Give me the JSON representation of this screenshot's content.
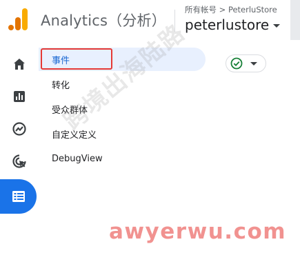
{
  "header": {
    "app_title": "Analytics（分析）",
    "account_path": "所有帐号 > PeterluStore",
    "property_name": "peterlustore"
  },
  "rail": {
    "items": [
      {
        "icon": "home-icon"
      },
      {
        "icon": "reports-icon"
      },
      {
        "icon": "explore-icon"
      },
      {
        "icon": "advertising-icon"
      },
      {
        "icon": "configure-icon",
        "active": true
      }
    ]
  },
  "subnav": {
    "items": [
      {
        "label": "事件",
        "selected": true
      },
      {
        "label": "转化"
      },
      {
        "label": "受众群体"
      },
      {
        "label": "自定义定义"
      },
      {
        "label": "DebugView"
      }
    ]
  },
  "status_chip": {
    "icon": "check-circle-icon"
  },
  "watermarks": {
    "chinese": "跨境出海陆路",
    "url": "awyerwu.com"
  },
  "colors": {
    "accent_blue": "#1a73e8",
    "selected_bg": "#e8f0fe",
    "highlight_red": "#e53935",
    "check_green": "#188038",
    "logo_orange": "#f9ab00",
    "logo_dark_orange": "#e37400"
  }
}
